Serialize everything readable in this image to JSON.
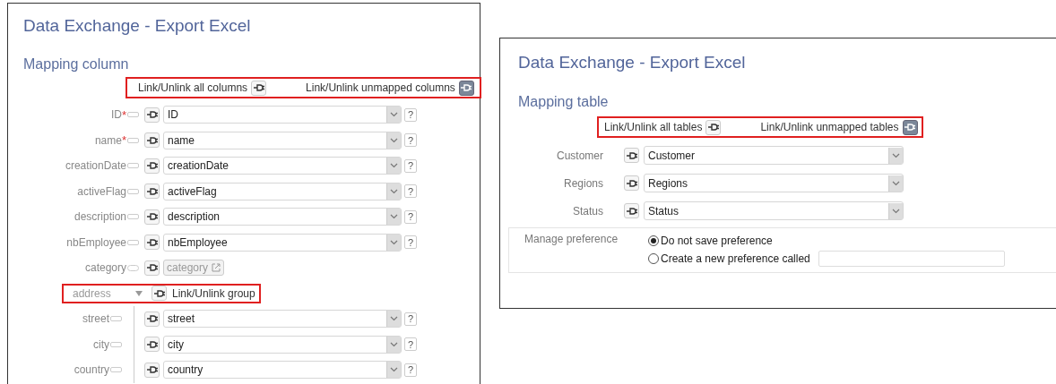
{
  "left_panel": {
    "title": "Data Exchange - Export Excel",
    "section": "Mapping column",
    "toolbar": [
      {
        "label": "Link/Unlink all columns",
        "on": false
      },
      {
        "label": "Link/Unlink unmapped columns",
        "on": true
      }
    ],
    "rows": [
      {
        "kind": "field",
        "label": "ID",
        "required_mark": "*",
        "value": "ID",
        "help": "?"
      },
      {
        "kind": "field",
        "label": "name",
        "required_mark": "*",
        "value": "name",
        "help": "?"
      },
      {
        "kind": "field",
        "label": "creationDate",
        "value": "creationDate",
        "help": "?"
      },
      {
        "kind": "field",
        "label": "activeFlag",
        "value": "activeFlag",
        "help": "?"
      },
      {
        "kind": "field",
        "label": "description",
        "value": "description",
        "help": "?"
      },
      {
        "kind": "field",
        "label": "nbEmployee",
        "value": "nbEmployee",
        "help": "?"
      },
      {
        "kind": "link",
        "label": "category",
        "value": "category"
      },
      {
        "kind": "group",
        "label": "address",
        "expanded": true,
        "action": "Link/Unlink group",
        "children": [
          {
            "label": "street",
            "value": "street",
            "help": "?"
          },
          {
            "label": "city",
            "value": "city",
            "help": "?"
          },
          {
            "label": "country",
            "value": "country",
            "help": "?"
          }
        ]
      }
    ]
  },
  "right_panel": {
    "title": "Data Exchange - Export Excel",
    "section": "Mapping table",
    "toolbar": [
      {
        "label": "Link/Unlink all tables",
        "on": false
      },
      {
        "label": "Link/Unlink unmapped tables",
        "on": true
      }
    ],
    "rows": [
      {
        "label": "Customer",
        "value": "Customer"
      },
      {
        "label": "Regions",
        "value": "Regions"
      },
      {
        "label": "Status",
        "value": "Status"
      }
    ],
    "preference": {
      "label": "Manage preference",
      "options": [
        {
          "label": "Do not save preference",
          "selected": true
        },
        {
          "label": "Create a new preference called",
          "selected": false,
          "has_input": true
        }
      ]
    }
  }
}
